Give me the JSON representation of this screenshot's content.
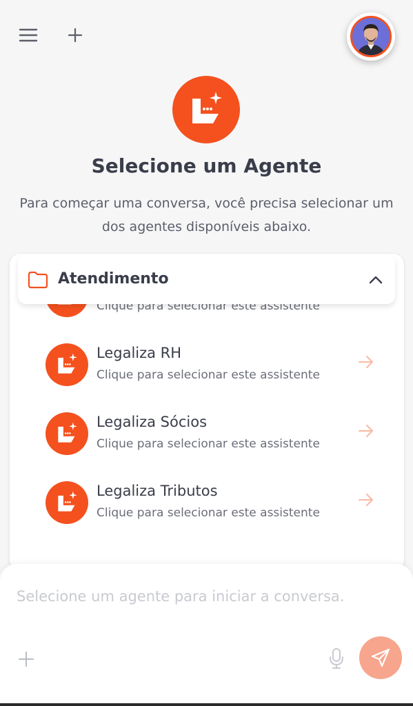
{
  "header": {
    "menu_icon": "hamburger-menu-icon",
    "new_chat_icon": "plus-icon",
    "avatar_icon": "user-avatar"
  },
  "hero": {
    "logo_icon": "agent-logo-icon",
    "title": "Selecione um Agente",
    "subtitle_line1": "Para começar uma conversa, você precisa selecionar um",
    "subtitle_line2": "dos agentes disponíveis abaixo."
  },
  "group": {
    "label": "Atendimento",
    "folder_icon": "folder-icon",
    "toggle_icon": "chevron-up-icon"
  },
  "agents": [
    {
      "name": "",
      "desc": "Clique para selecionar este assistente"
    },
    {
      "name": "Legaliza RH",
      "desc": "Clique para selecionar este assistente"
    },
    {
      "name": "Legaliza Sócios",
      "desc": "Clique para selecionar este assistente"
    },
    {
      "name": "Legaliza Tributos",
      "desc": "Clique para selecionar este assistente"
    }
  ],
  "composer": {
    "placeholder": "Selecione um agente para iniciar a conversa.",
    "value": "",
    "attach_icon": "plus-icon",
    "mic_icon": "microphone-icon",
    "send_icon": "send-icon"
  },
  "colors": {
    "accent": "#f4511e",
    "send_disabled": "#f7a58c",
    "background": "#f6f6f7"
  }
}
